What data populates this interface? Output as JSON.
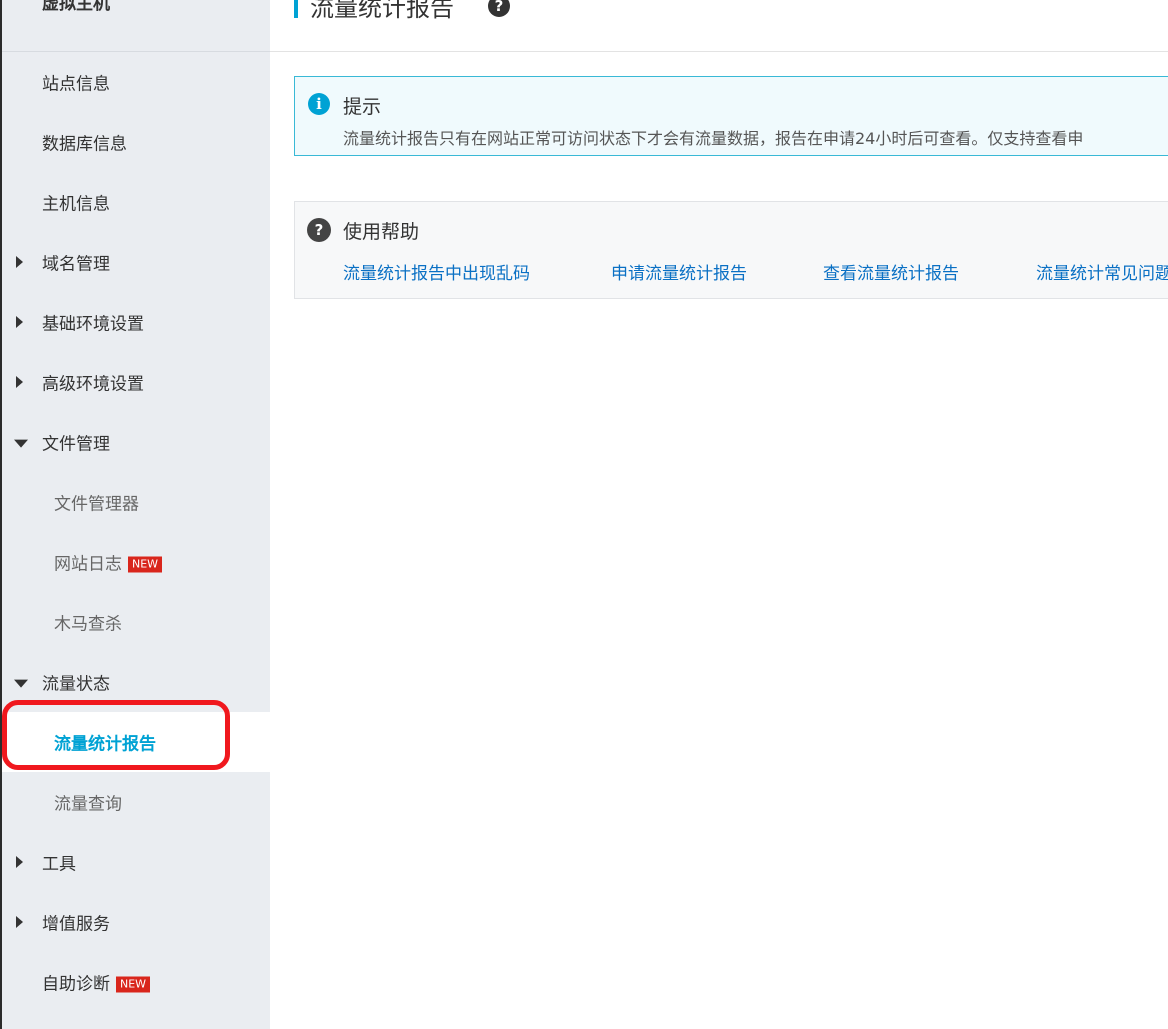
{
  "sidebar": {
    "title": "虚拟主机",
    "items": [
      {
        "label": "站点信息",
        "level": "top",
        "arrow": "none"
      },
      {
        "label": "数据库信息",
        "level": "top",
        "arrow": "none"
      },
      {
        "label": "主机信息",
        "level": "top",
        "arrow": "none"
      },
      {
        "label": "域名管理",
        "level": "top",
        "arrow": "right"
      },
      {
        "label": "基础环境设置",
        "level": "top",
        "arrow": "right"
      },
      {
        "label": "高级环境设置",
        "level": "top",
        "arrow": "right"
      },
      {
        "label": "文件管理",
        "level": "top",
        "arrow": "down"
      },
      {
        "label": "文件管理器",
        "level": "sub",
        "arrow": "none"
      },
      {
        "label": "网站日志",
        "level": "sub",
        "arrow": "none",
        "badge": "NEW"
      },
      {
        "label": "木马查杀",
        "level": "sub",
        "arrow": "none"
      },
      {
        "label": "流量状态",
        "level": "top",
        "arrow": "down"
      },
      {
        "label": "流量统计报告",
        "level": "sub",
        "arrow": "none",
        "active": true
      },
      {
        "label": "流量查询",
        "level": "sub",
        "arrow": "none"
      },
      {
        "label": "工具",
        "level": "top",
        "arrow": "right"
      },
      {
        "label": "增值服务",
        "level": "top",
        "arrow": "right"
      },
      {
        "label": "自助诊断",
        "level": "top",
        "arrow": "none",
        "badge": "NEW"
      }
    ]
  },
  "header": {
    "title": "流量统计报告",
    "help_icon": "question-circle-icon",
    "help_glyph": "?"
  },
  "tip": {
    "icon": "info-icon",
    "icon_glyph": "i",
    "title": "提示",
    "text": "流量统计报告只有在网站正常可访问状态下才会有流量数据，报告在申请24小时后可查看。仅支持查看申"
  },
  "help": {
    "icon": "question-circle-icon",
    "icon_glyph": "?",
    "title": "使用帮助",
    "links": [
      "流量统计报告中出现乱码",
      "申请流量统计报告",
      "查看流量统计报告",
      "流量统计常见问题"
    ]
  },
  "colors": {
    "accent": "#00a2d4",
    "link": "#0a70c4",
    "badge": "#d9261c",
    "highlight": "#f0181e",
    "sidebar_bg": "#eaedf1"
  }
}
